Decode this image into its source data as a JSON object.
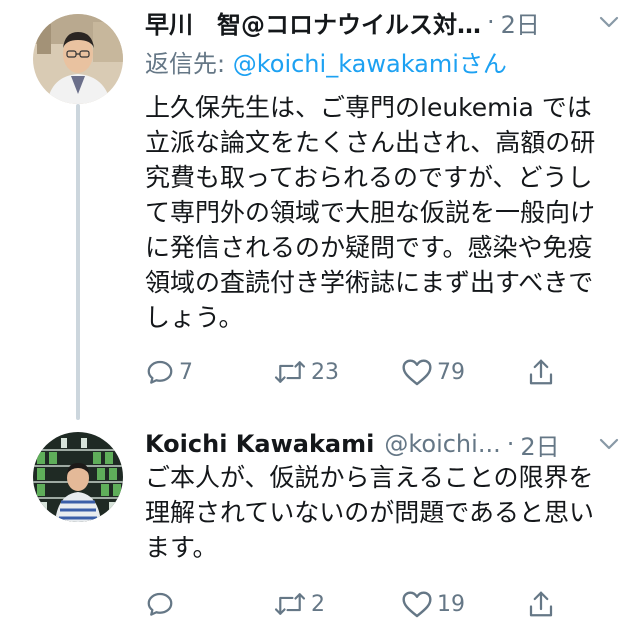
{
  "tweets": [
    {
      "name": "早川　智@コロナウイルス対…",
      "handle": "",
      "separator": "·",
      "time": "2日",
      "reply_prefix": "返信先: ",
      "reply_mention": "@koichi_kawakami",
      "reply_suffix": "さん",
      "body": "上久保先生は、ご専門のleukemia では立派な論文をたくさん出され、高額の研究費も取っておられるのですが、どうして専門外の領域で大胆な仮説を一般向けに発信されるのか疑問です。感染や免疫領域の査読付き学術誌にまず出すべきでしょう。",
      "reply_count": "7",
      "retweet_count": "23",
      "like_count": "79",
      "icons": {
        "reply": "reply-icon",
        "retweet": "retweet-icon",
        "like": "heart-icon",
        "share": "share-icon",
        "caret": "chevron-down-icon"
      }
    },
    {
      "name": "Koichi Kawakami",
      "handle": "@koichi...",
      "separator": "·",
      "time": "2日",
      "body": "ご本人が、仮説から言えることの限界を理解されていないのが問題であると思います。",
      "reply_count": "",
      "retweet_count": "2",
      "like_count": "19"
    }
  ],
  "colors": {
    "text": "#14171a",
    "secondary": "#657786",
    "link": "#1da1f2",
    "thread_line": "#ccd6dd",
    "background": "#ffffff"
  }
}
